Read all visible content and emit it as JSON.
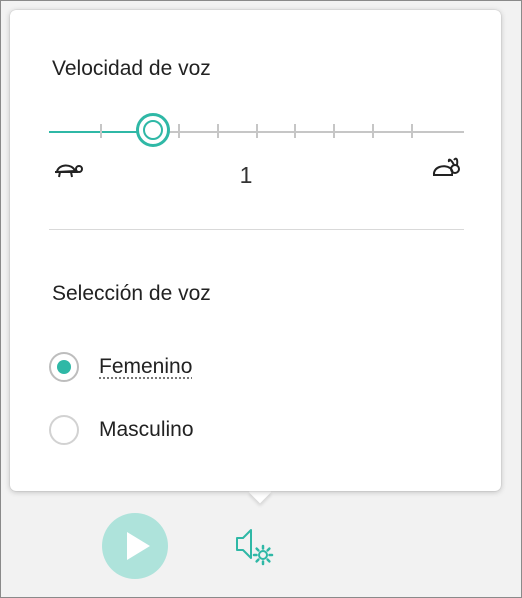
{
  "speed": {
    "title": "Velocidad de voz",
    "value_label": "1",
    "level": 0.25,
    "tick_count": 9,
    "slow_icon": "turtle-icon",
    "fast_icon": "rabbit-icon"
  },
  "voice": {
    "title": "Selección de voz",
    "options": [
      {
        "label": "Femenino",
        "selected": true
      },
      {
        "label": "Masculino",
        "selected": false
      }
    ]
  },
  "toolbar": {
    "play_icon": "play-icon",
    "settings_icon": "voice-settings-icon"
  },
  "colors": {
    "accent": "#2fb8a6",
    "play_background": "#aee3db",
    "track": "#c6c6c6"
  }
}
